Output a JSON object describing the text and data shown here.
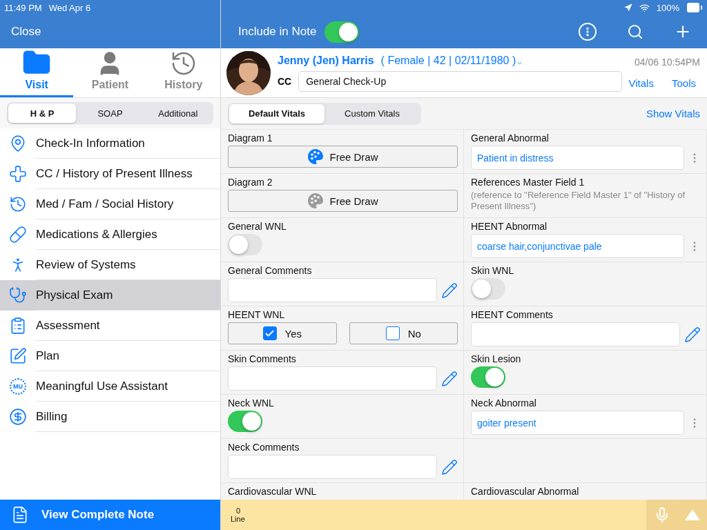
{
  "status_bar": {
    "time": "11:49 PM",
    "date": "Wed Apr 6",
    "battery": "100%"
  },
  "sidebar": {
    "close": "Close",
    "tabs": [
      {
        "label": "Visit",
        "selected": true
      },
      {
        "label": "Patient",
        "selected": false
      },
      {
        "label": "History",
        "selected": false
      }
    ],
    "segments": [
      {
        "label": "H & P",
        "selected": true
      },
      {
        "label": "SOAP",
        "selected": false
      },
      {
        "label": "Additional",
        "selected": false
      }
    ],
    "items": [
      {
        "label": "Check-In Information",
        "selected": false
      },
      {
        "label": "CC / History of Present Illness",
        "selected": false
      },
      {
        "label": "Med / Fam / Social History",
        "selected": false
      },
      {
        "label": "Medications & Allergies",
        "selected": false
      },
      {
        "label": "Review of Systems",
        "selected": false
      },
      {
        "label": "Physical Exam",
        "selected": true
      },
      {
        "label": "Assessment",
        "selected": false
      },
      {
        "label": "Plan",
        "selected": false
      },
      {
        "label": "Meaningful Use Assistant",
        "selected": false,
        "badge": "MU"
      },
      {
        "label": "Billing",
        "selected": false
      }
    ],
    "footer_button": "View Complete Note"
  },
  "toolbar": {
    "include_in_note": {
      "label": "Include in Note",
      "on": true
    }
  },
  "patient": {
    "name": "Jenny (Jen) Harris",
    "details": "( Female | 42 | 02/11/1980 )",
    "timestamp": "04/06 10:54PM",
    "cc_label": "CC",
    "cc_value": "General Check-Up",
    "links": [
      "Vitals",
      "Tools"
    ]
  },
  "vitals_tabs": [
    {
      "label": "Default Vitals",
      "selected": true
    },
    {
      "label": "Custom Vitals",
      "selected": false
    }
  ],
  "show_vitals": "Show Vitals",
  "rows": [
    [
      {
        "kind": "draw",
        "label": "Diagram 1",
        "button": "Free Draw",
        "has_drawing": true
      },
      {
        "kind": "abnormal",
        "label": "General Abnormal",
        "value": "Patient in distress"
      }
    ],
    [
      {
        "kind": "draw",
        "label": "Diagram 2",
        "button": "Free Draw",
        "has_drawing": false
      },
      {
        "kind": "reference",
        "label": "References Master Field 1",
        "text": "(reference to \"Reference Field Master 1\" of \"History of Present Illness\")"
      }
    ],
    [
      {
        "kind": "toggle",
        "label": "General WNL",
        "on": false
      },
      {
        "kind": "abnormal",
        "label": "HEENT Abnormal",
        "value": "coarse hair,conjunctivae pale"
      }
    ],
    [
      {
        "kind": "comment",
        "label": "General Comments"
      },
      {
        "kind": "toggle",
        "label": "Skin WNL",
        "on": false
      }
    ],
    [
      {
        "kind": "yesno",
        "label": "HEENT WNL",
        "options": [
          {
            "label": "Yes",
            "checked": true
          },
          {
            "label": "No",
            "checked": false
          }
        ]
      },
      {
        "kind": "comment",
        "label": "HEENT Comments"
      }
    ],
    [
      {
        "kind": "comment",
        "label": "Skin Comments"
      },
      {
        "kind": "toggle",
        "label": "Skin Lesion",
        "on": true
      }
    ],
    [
      {
        "kind": "toggle",
        "label": "Neck WNL",
        "on": true
      },
      {
        "kind": "abnormal",
        "label": "Neck Abnormal",
        "value": "goiter present"
      }
    ],
    [
      {
        "kind": "comment",
        "label": "Neck Comments"
      },
      {
        "kind": "empty"
      }
    ],
    [
      {
        "kind": "heading",
        "label": "Cardiovascular WNL"
      },
      {
        "kind": "heading",
        "label": "Cardiovascular Abnormal"
      }
    ]
  ],
  "bottom_bar": {
    "count": "0",
    "label": "Line"
  }
}
